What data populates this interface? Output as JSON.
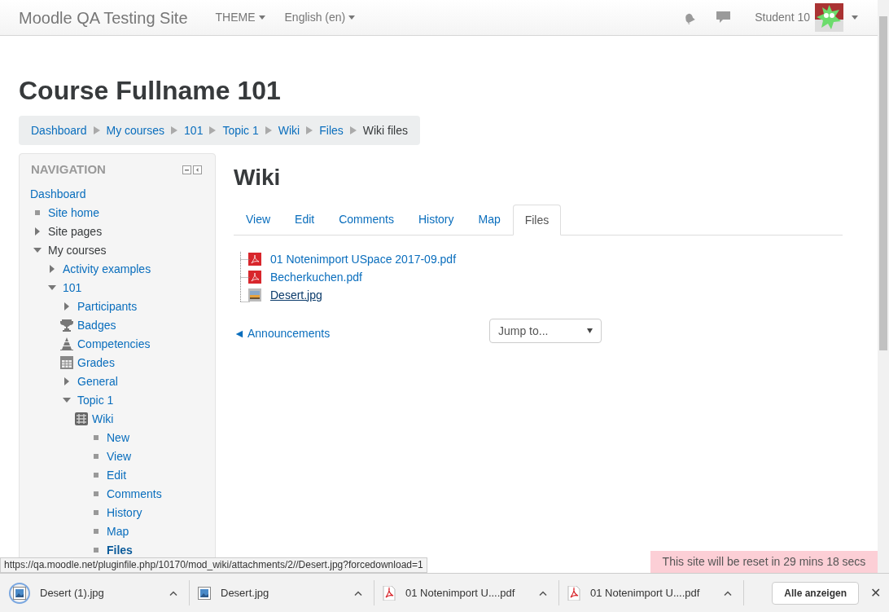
{
  "navbar": {
    "brand": "Moodle QA Testing Site",
    "menus": [
      "THEME",
      "English (en)"
    ],
    "user": "Student 10"
  },
  "page_title": "Course Fullname 101",
  "breadcrumb": [
    {
      "label": "Dashboard",
      "current": false
    },
    {
      "label": "My courses",
      "current": false
    },
    {
      "label": "101",
      "current": false
    },
    {
      "label": "Topic 1",
      "current": false
    },
    {
      "label": "Wiki",
      "current": false
    },
    {
      "label": "Files",
      "current": false
    },
    {
      "label": "Wiki files",
      "current": true
    }
  ],
  "navigation": {
    "title": "NAVIGATION",
    "items": [
      {
        "label": "Dashboard",
        "kind": "link",
        "selected": false
      },
      {
        "label": "Site home",
        "kind": "bullet",
        "selected": false
      },
      {
        "label": "Site pages",
        "kind": "branch",
        "expanded": false,
        "selected": false
      },
      {
        "label": "My courses",
        "kind": "branch",
        "expanded": true,
        "selected": false,
        "children": [
          {
            "label": "Activity examples",
            "kind": "branch",
            "expanded": false,
            "selected": false
          },
          {
            "label": "101",
            "kind": "branch",
            "expanded": true,
            "selected": false,
            "children": [
              {
                "label": "Participants",
                "kind": "branch",
                "expanded": false,
                "selected": false
              },
              {
                "label": "Badges",
                "kind": "trophy",
                "selected": false
              },
              {
                "label": "Competencies",
                "kind": "competency",
                "selected": false
              },
              {
                "label": "Grades",
                "kind": "grades",
                "selected": false
              },
              {
                "label": "General",
                "kind": "branch",
                "expanded": false,
                "selected": false
              },
              {
                "label": "Topic 1",
                "kind": "branch",
                "expanded": true,
                "selected": false,
                "children": [
                  {
                    "label": "Wiki",
                    "kind": "wiki",
                    "selected": false,
                    "children": [
                      {
                        "label": "New",
                        "kind": "bullet",
                        "selected": false
                      },
                      {
                        "label": "View",
                        "kind": "bullet",
                        "selected": false
                      },
                      {
                        "label": "Edit",
                        "kind": "bullet",
                        "selected": false
                      },
                      {
                        "label": "Comments",
                        "kind": "bullet",
                        "selected": false
                      },
                      {
                        "label": "History",
                        "kind": "bullet",
                        "selected": false
                      },
                      {
                        "label": "Map",
                        "kind": "bullet",
                        "selected": false
                      },
                      {
                        "label": "Files",
                        "kind": "bullet",
                        "selected": true
                      }
                    ]
                  }
                ]
              }
            ]
          }
        ]
      }
    ]
  },
  "main": {
    "heading": "Wiki",
    "tabs": [
      {
        "label": "View",
        "selected": false
      },
      {
        "label": "Edit",
        "selected": false
      },
      {
        "label": "Comments",
        "selected": false
      },
      {
        "label": "History",
        "selected": false
      },
      {
        "label": "Map",
        "selected": false
      },
      {
        "label": "Files",
        "selected": true
      }
    ],
    "files": [
      {
        "name": "01 Notenimport USpace 2017-09.pdf",
        "kind": "pdf",
        "hovered": false
      },
      {
        "name": "Becherkuchen.pdf",
        "kind": "pdf",
        "hovered": false
      },
      {
        "name": "Desert.jpg",
        "kind": "image",
        "hovered": true
      }
    ],
    "previous_link": "◄ Announcements",
    "jump_to": {
      "value": "Jump to..."
    }
  },
  "status_url": "https://qa.moodle.net/pluginfile.php/10170/mod_wiki/attachments/2//Desert.jpg?forcedownload=1",
  "reset_notice": "This site will be reset in 29 mins 18 secs",
  "downloads": {
    "items": [
      {
        "name": "Desert (1).jpg",
        "kind": "image",
        "selected": true
      },
      {
        "name": "Desert.jpg",
        "kind": "image",
        "selected": false
      },
      {
        "name": "01 Notenimport U....pdf",
        "kind": "pdf",
        "selected": false
      },
      {
        "name": "01 Notenimport U....pdf",
        "kind": "pdf",
        "selected": false
      }
    ],
    "show_all": "Alle anzeigen",
    "close": "✕"
  }
}
